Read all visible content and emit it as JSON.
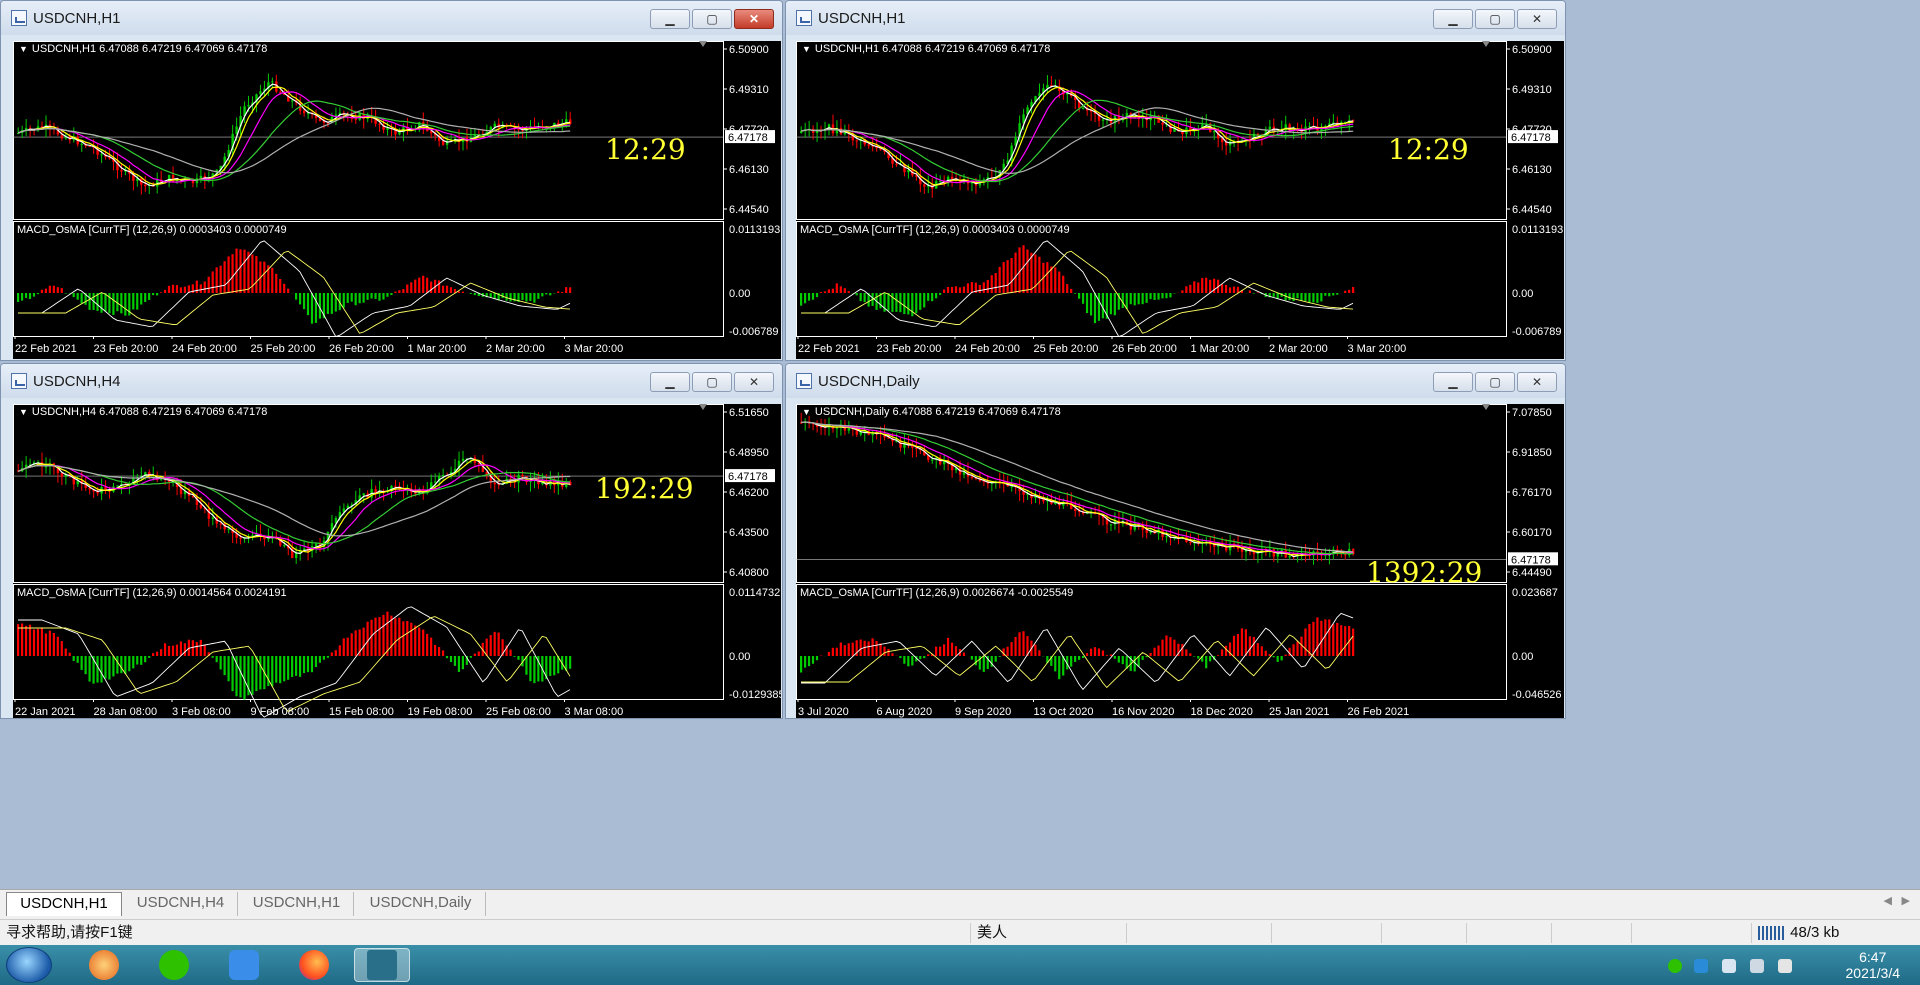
{
  "charts": [
    {
      "id": "w1",
      "title": "USDCNH,H1",
      "close_active": true,
      "header": "USDCNH,H1  6.47088 6.47219 6.47069 6.47178",
      "price_axis": [
        "6.50900",
        "6.49310",
        "6.47720",
        "6.46130",
        "6.44540"
      ],
      "price_range": [
        6.4375,
        6.512
      ],
      "current_price": "6.47178",
      "current_value": 6.47178,
      "countdown": "12:29",
      "macd_header": "MACD_OsMA [CurrTF] (12,26,9) 0.0003403 0.0000749",
      "macd_axis": [
        "0.0113193",
        "0.00",
        "-0.006789"
      ],
      "time_axis": [
        "22 Feb 2021",
        "23 Feb 20:00",
        "24 Feb 20:00",
        "25 Feb 20:00",
        "26 Feb 20:00",
        "1 Mar 20:00",
        "2 Mar 20:00",
        "3 Mar 20:00"
      ],
      "shape": [
        0.52,
        0.48,
        0.55,
        0.62,
        0.75,
        0.88,
        0.82,
        0.85,
        0.78,
        0.35,
        0.18,
        0.32,
        0.45,
        0.4,
        0.42,
        0.52,
        0.46,
        0.6,
        0.55,
        0.48,
        0.5,
        0.47,
        0.45
      ],
      "macd_shape": [
        -0.2,
        0.15,
        -0.3,
        -0.4,
        0.1,
        0.2,
        0.85,
        0.4,
        -0.55,
        -0.2,
        -0.1,
        0.3,
        0.05,
        -0.1,
        -0.15,
        0.1
      ]
    },
    {
      "id": "w2",
      "title": "USDCNH,H1",
      "close_active": false,
      "header": "USDCNH,H1  6.47088 6.47219 6.47069 6.47178",
      "price_axis": [
        "6.50900",
        "6.49310",
        "6.47720",
        "6.46130",
        "6.44540"
      ],
      "price_range": [
        6.4375,
        6.512
      ],
      "current_price": "6.47178",
      "current_value": 6.47178,
      "countdown": "12:29",
      "macd_header": "MACD_OsMA [CurrTF] (12,26,9) 0.0003403 0.0000749",
      "macd_axis": [
        "0.0113193",
        "0.00",
        "-0.006789"
      ],
      "time_axis": [
        "22 Feb 2021",
        "23 Feb 20:00",
        "24 Feb 20:00",
        "25 Feb 20:00",
        "26 Feb 20:00",
        "1 Mar 20:00",
        "2 Mar 20:00",
        "3 Mar 20:00"
      ],
      "shape": [
        0.52,
        0.48,
        0.55,
        0.62,
        0.75,
        0.88,
        0.82,
        0.85,
        0.78,
        0.35,
        0.18,
        0.32,
        0.45,
        0.4,
        0.42,
        0.52,
        0.46,
        0.6,
        0.55,
        0.48,
        0.5,
        0.47,
        0.45
      ],
      "macd_shape": [
        -0.2,
        0.15,
        -0.3,
        -0.4,
        0.1,
        0.2,
        0.85,
        0.4,
        -0.55,
        -0.2,
        -0.1,
        0.3,
        0.05,
        -0.1,
        -0.15,
        0.1
      ]
    },
    {
      "id": "w3",
      "title": "USDCNH,H4",
      "close_active": false,
      "header": "USDCNH,H4  6.47088 6.47219 6.47069 6.47178",
      "price_axis": [
        "6.51650",
        "6.48950",
        "6.46200",
        "6.43500",
        "6.40800"
      ],
      "price_range": [
        6.398,
        6.522
      ],
      "current_price": "6.47178",
      "current_value": 6.47178,
      "countdown": "192:29",
      "macd_header": "MACD_OsMA [CurrTF] (12,26,9) 0.0014564 0.0024191",
      "macd_axis": [
        "0.0114732",
        "0.00",
        "-0.0129385"
      ],
      "time_axis": [
        "22 Jan 2021",
        "28 Jan 08:00",
        "3 Feb 08:00",
        "9 Feb 08:00",
        "15 Feb 08:00",
        "19 Feb 08:00",
        "25 Feb 08:00",
        "3 Mar 08:00"
      ],
      "shape": [
        0.35,
        0.3,
        0.4,
        0.5,
        0.45,
        0.38,
        0.42,
        0.55,
        0.72,
        0.8,
        0.78,
        0.92,
        0.85,
        0.6,
        0.5,
        0.45,
        0.5,
        0.38,
        0.25,
        0.45,
        0.4,
        0.43,
        0.45
      ],
      "macd_shape": [
        0.6,
        0.4,
        -0.5,
        -0.3,
        0.2,
        0.3,
        -0.8,
        -0.5,
        -0.3,
        0.4,
        0.8,
        0.5,
        -0.3,
        0.5,
        -0.5,
        -0.2
      ]
    },
    {
      "id": "w4",
      "title": "USDCNH,Daily",
      "close_active": false,
      "header": "USDCNH,Daily  6.47088 6.47219 6.47069 6.47178",
      "price_axis": [
        "7.07850",
        "6.91850",
        "6.76170",
        "6.60170",
        "6.44490"
      ],
      "price_range": [
        6.38,
        7.1
      ],
      "current_price": "6.47178",
      "current_value": 6.47178,
      "countdown": "1392:29",
      "macd_header": "MACD_OsMA [CurrTF] (12,26,9) 0.0026674 -0.0025549",
      "macd_axis": [
        "0.023687",
        "0.00",
        "-0.046526"
      ],
      "time_axis": [
        "3 Jul 2020",
        "6 Aug 2020",
        "9 Sep 2020",
        "13 Oct 2020",
        "16 Nov 2020",
        "18 Dec 2020",
        "25 Jan 2021",
        "26 Feb 2021"
      ],
      "shape": [
        0.03,
        0.05,
        0.08,
        0.12,
        0.18,
        0.25,
        0.33,
        0.4,
        0.45,
        0.5,
        0.56,
        0.6,
        0.68,
        0.72,
        0.75,
        0.8,
        0.84,
        0.86,
        0.89,
        0.9,
        0.92,
        0.9,
        0.89
      ],
      "macd_shape": [
        -0.3,
        0.2,
        0.3,
        -0.2,
        0.3,
        -0.3,
        0.5,
        -0.4,
        0.2,
        -0.3,
        0.4,
        -0.2,
        0.5,
        -0.1,
        0.7,
        0.5
      ]
    }
  ],
  "tabs": [
    "USDCNH,H1",
    "USDCNH,H4",
    "USDCNH,H1",
    "USDCNH,Daily"
  ],
  "status": {
    "help": "寻求帮助,请按F1键",
    "profile": "美人",
    "traffic": "48/3 kb"
  },
  "taskbar": {
    "time": "6:47",
    "date": "2021/3/4"
  },
  "colors": {
    "bull": "#00cc00",
    "bear": "#ff0000",
    "ma_fast": "#ffff00",
    "ma_mid": "#ffffff",
    "ma_magenta": "#ff00ff",
    "ma_green": "#33cc33",
    "ma_gray": "#b0b0b0",
    "countdown": "#ffff33"
  }
}
